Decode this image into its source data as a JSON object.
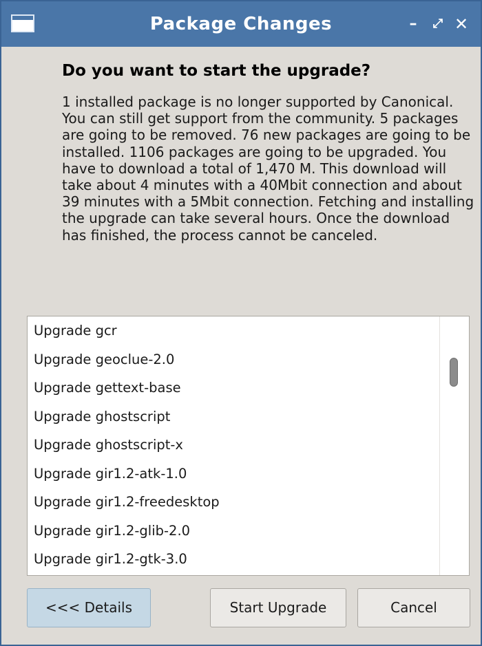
{
  "window": {
    "title": "Package Changes",
    "controls": {
      "minimize": "–",
      "maximize": "⤢",
      "close": "✕"
    }
  },
  "dialog": {
    "heading": "Do you want to start the upgrade?",
    "description": "1 installed package is no longer supported by Canonical. You can still get support from the community. 5 packages are going to be removed. 76 new packages are going to be installed. 1106 packages are going to be upgraded. You have to download a total of 1,470 M. This download will take about 4 minutes with a 40Mbit connection and about 39 minutes with a 5Mbit connection. Fetching and installing the upgrade can take several hours. Once the download has finished, the process cannot be canceled."
  },
  "changes": {
    "items": [
      "Upgrade gcr",
      "Upgrade geoclue-2.0",
      "Upgrade gettext-base",
      "Upgrade ghostscript",
      "Upgrade ghostscript-x",
      "Upgrade gir1.2-atk-1.0",
      "Upgrade gir1.2-freedesktop",
      "Upgrade gir1.2-glib-2.0",
      "Upgrade gir1.2-gtk-3.0"
    ]
  },
  "buttons": {
    "details": "<<< Details",
    "start_upgrade": "Start Upgrade",
    "cancel": "Cancel"
  }
}
